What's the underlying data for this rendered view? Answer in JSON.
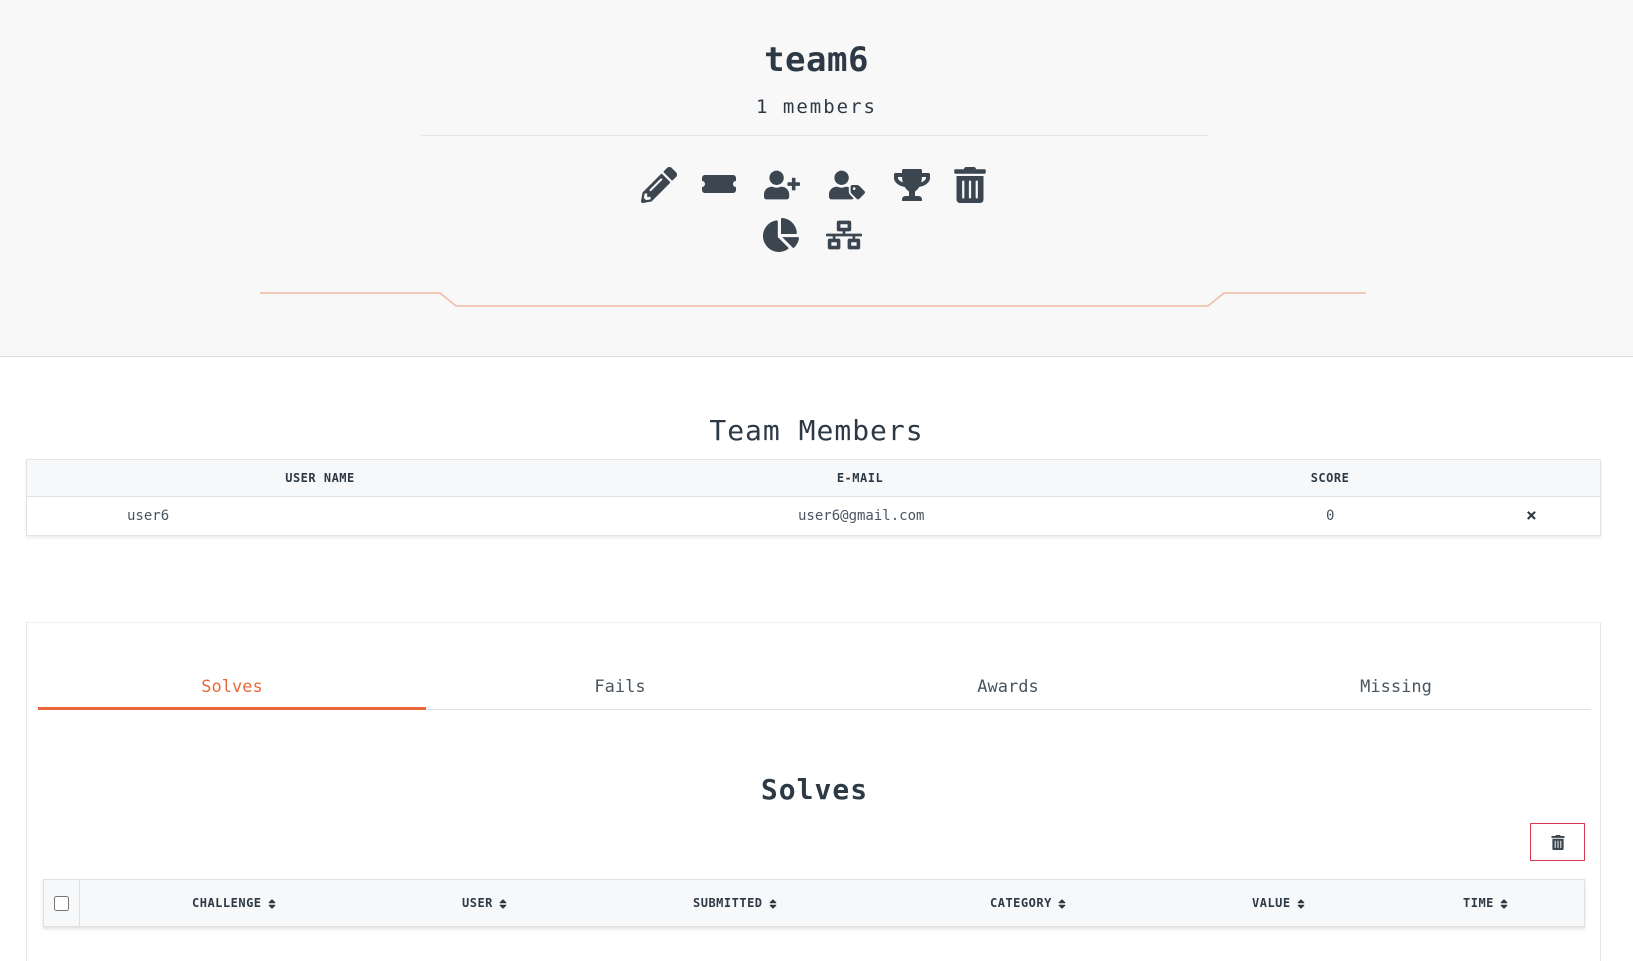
{
  "team": {
    "name": "team6",
    "members_count": "1 members"
  },
  "actions": [
    {
      "name": "edit-team",
      "icon": "pencil-icon"
    },
    {
      "name": "view-token",
      "icon": "ticket-icon"
    },
    {
      "name": "add-member",
      "icon": "user-plus-icon"
    },
    {
      "name": "choose-captain",
      "icon": "user-tag-icon"
    },
    {
      "name": "award-team",
      "icon": "trophy-icon"
    },
    {
      "name": "delete-team",
      "icon": "trash-icon"
    },
    {
      "name": "view-stats",
      "icon": "chart-pie-icon"
    },
    {
      "name": "view-addresses",
      "icon": "network-icon"
    }
  ],
  "members_section": {
    "title": "Team Members",
    "headers": {
      "username": "USER NAME",
      "email": "E-MAIL",
      "score": "SCORE"
    },
    "rows": [
      {
        "username": "user6",
        "email": "user6@gmail.com",
        "score": "0",
        "remove": "×"
      }
    ]
  },
  "tabs": [
    {
      "label": "Solves",
      "active": true
    },
    {
      "label": "Fails",
      "active": false
    },
    {
      "label": "Awards",
      "active": false
    },
    {
      "label": "Missing",
      "active": false
    }
  ],
  "solves": {
    "title": "Solves",
    "headers": {
      "challenge": "CHALLENGE",
      "user": "USER",
      "submitted": "SUBMITTED",
      "category": "CATEGORY",
      "value": "VALUE",
      "time": "TIME"
    }
  },
  "colors": {
    "accent": "#e8673b",
    "text": "#2d3a46",
    "danger": "#d9394f"
  }
}
